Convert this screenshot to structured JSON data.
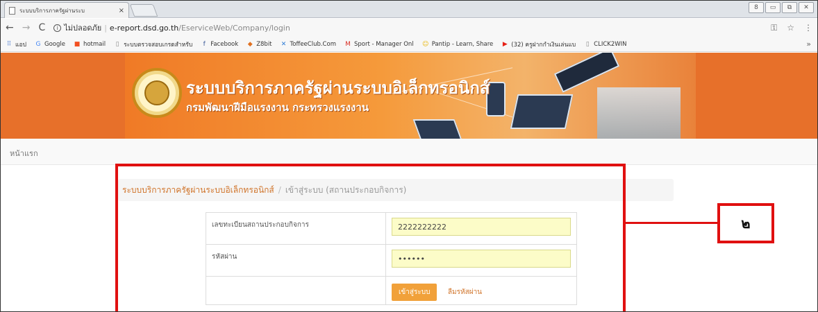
{
  "browser": {
    "tab_title": "ระบบบริการภาครัฐผ่านระบ",
    "tab_close": "×",
    "window_controls": [
      "8",
      "▭",
      "⧉",
      "✕"
    ],
    "nav": {
      "back": "←",
      "forward": "→",
      "reload": "C"
    },
    "address": {
      "info_icon": "i",
      "insecure_label": "ไม่ปลอดภัย",
      "separator": "|",
      "host": "e-report.dsd.go.th",
      "path": "/EserviceWeb/Company/login"
    },
    "toolbar_icons": {
      "key": "⚿",
      "star": "☆",
      "menu": "⋮"
    },
    "bookmarks": [
      {
        "icon": "apps-icon",
        "glyph": "⠿",
        "color": "#4a7bd0",
        "label": "แอป"
      },
      {
        "icon": "google-icon",
        "glyph": "G",
        "color": "#4285f4",
        "label": "Google"
      },
      {
        "icon": "hotmail-icon",
        "glyph": "■",
        "color": "#f25022",
        "label": "hotmail"
      },
      {
        "icon": "page-icon",
        "glyph": "▯",
        "color": "#888888",
        "label": "ระบบตรวจสอบเกรดสำหรับ"
      },
      {
        "icon": "facebook-icon",
        "glyph": "f",
        "color": "#3b5998",
        "label": "Facebook"
      },
      {
        "icon": "zbbit-icon",
        "glyph": "◆",
        "color": "#e07020",
        "label": "Z8bit"
      },
      {
        "icon": "toffee-icon",
        "glyph": "✕",
        "color": "#2b7bd6",
        "label": "ToffeeClub.Com"
      },
      {
        "icon": "gmail-icon",
        "glyph": "M",
        "color": "#d93025",
        "label": "Sport - Manager Onl"
      },
      {
        "icon": "pantip-icon",
        "glyph": "☺",
        "color": "#e8b400",
        "label": "Pantip - Learn, Share"
      },
      {
        "icon": "youtube-icon",
        "glyph": "▶",
        "color": "#e62117",
        "label": "(32) ครูฝากกำเงินเล่นแบ"
      },
      {
        "icon": "page-icon",
        "glyph": "▯",
        "color": "#888888",
        "label": "CLICK2WIN"
      }
    ],
    "bookmarks_more": "»"
  },
  "banner": {
    "title": "ระบบบริการภาครัฐผ่านระบบอิเล็กทรอนิกส์",
    "subtitle": "กรมพัฒนาฝีมือแรงงาน กระทรวงแรงงาน"
  },
  "nav": {
    "home": "หน้าแรก"
  },
  "breadcrumb": {
    "root": "ระบบบริการภาครัฐผ่านระบบอิเล็กทรอนิกส์",
    "separator": "/",
    "current": "เข้าสู่ระบบ (สถานประกอบกิจการ)"
  },
  "form": {
    "registration_label": "เลขทะเบียนสถานประกอบกิจการ",
    "registration_value": "2222222222",
    "password_label": "รหัสผ่าน",
    "password_value": "••••••",
    "login_button": "เข้าสู่ระบบ",
    "forgot_link": "ลืมรหัสผ่าน"
  },
  "annotation": {
    "label": "๒",
    "color": "#e01010"
  }
}
